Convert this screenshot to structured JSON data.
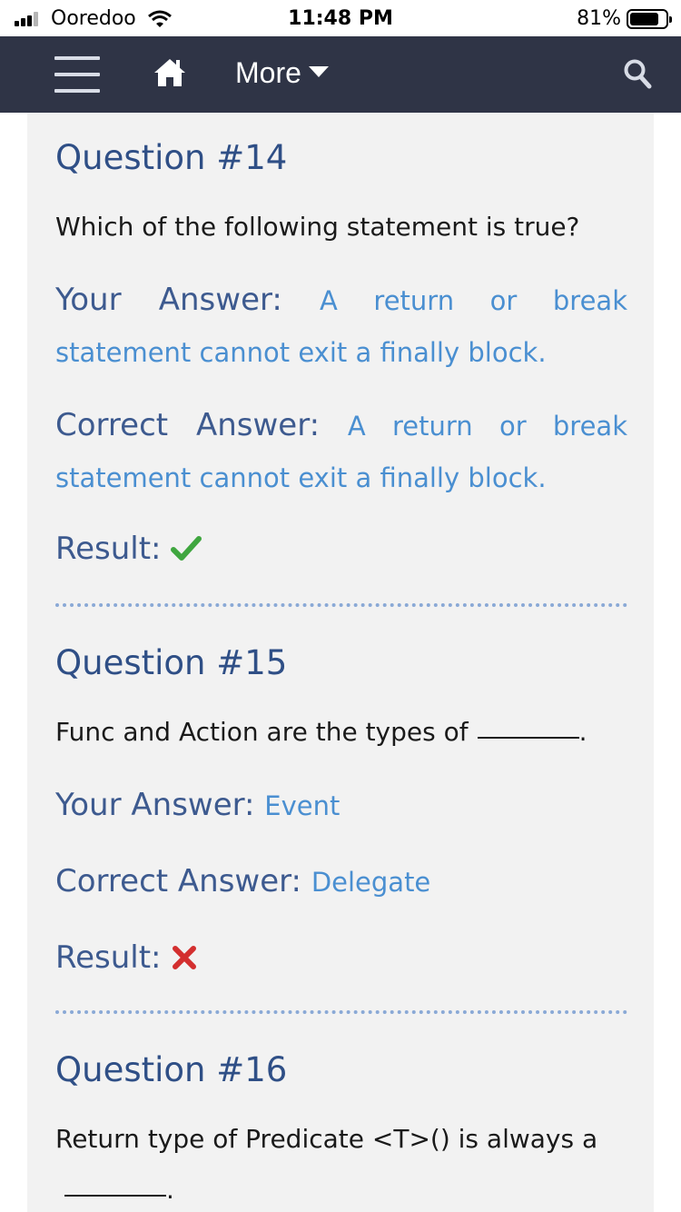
{
  "status_bar": {
    "carrier": "Ooredoo",
    "time": "11:48 PM",
    "battery": "81%",
    "battery_level": 0.81
  },
  "navbar": {
    "more_label": "More"
  },
  "labels": {
    "your_answer": "Your Answer:",
    "correct_answer": "Correct Answer:",
    "result": "Result:"
  },
  "questions": [
    {
      "title": "Question #14",
      "text": "Which of the following statement is true?",
      "your_answer": "A return or break statement cannot exit a finally block.",
      "correct_answer": "A return or break statement cannot exit a finally block.",
      "result": "correct"
    },
    {
      "title": "Question #15",
      "text": "Func and Action are the types of",
      "your_answer": "Event",
      "correct_answer": "Delegate",
      "result": "incorrect"
    },
    {
      "title": "Question #16",
      "text": "Return type of Predicate <T>() is always a",
      "your_answer": "",
      "correct_answer": "",
      "result": ""
    }
  ],
  "icons": {
    "check": "check-icon",
    "cross": "cross-icon",
    "colors": {
      "check": "#3fa63f",
      "cross": "#d32f2f",
      "navbar": "#2f3446",
      "link": "#4a8fd1",
      "heading": "#2f4f86"
    }
  }
}
